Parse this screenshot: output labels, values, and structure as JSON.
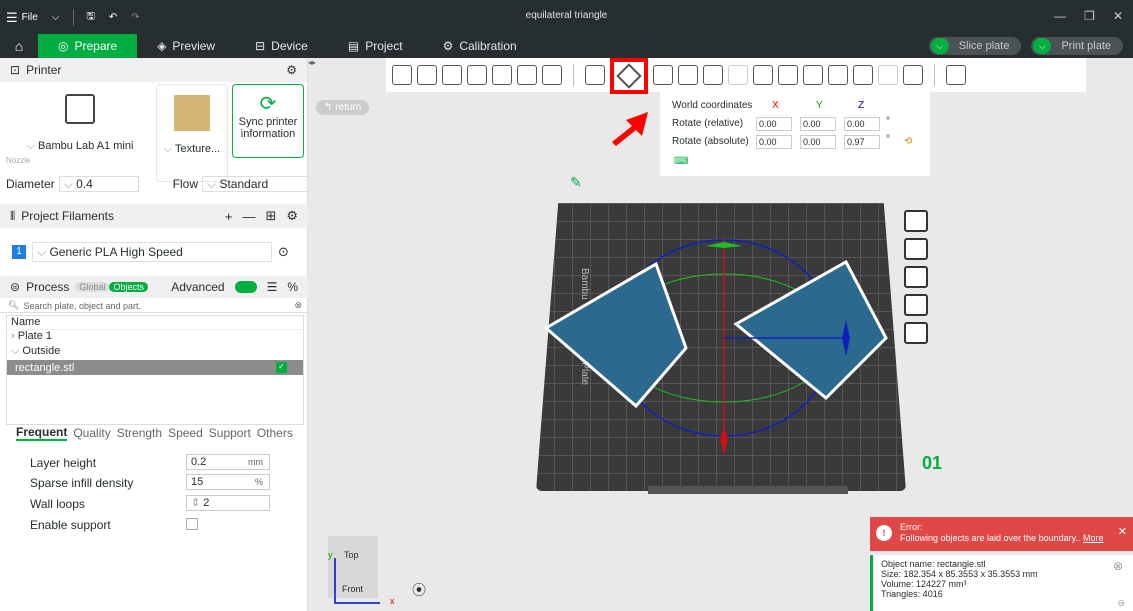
{
  "titlebar": {
    "menu": "File",
    "title": "equilateral triangle"
  },
  "nav": {
    "tabs": [
      "Prepare",
      "Preview",
      "Device",
      "Project",
      "Calibration"
    ],
    "slice": "Slice plate",
    "print": "Print plate"
  },
  "printer": {
    "header": "Printer",
    "name": "Bambu Lab A1 mini",
    "plate": "Texture...",
    "sync": "Sync printer information",
    "nozzle": "Nozzle",
    "diameter_label": "Diameter",
    "diameter": "0.4",
    "flow_label": "Flow",
    "flow": "Standard"
  },
  "filaments": {
    "header": "Project Filaments",
    "slot": "1",
    "name": "Generic PLA High Speed"
  },
  "process": {
    "header": "Process",
    "global": "Global",
    "objects": "Objects",
    "advanced": "Advanced",
    "search_placeholder": "Search plate, object and part.",
    "name_col": "Name",
    "tree": [
      "Plate 1",
      "Outside",
      "rectangle.stl"
    ]
  },
  "tabs": [
    "Frequent",
    "Quality",
    "Strength",
    "Speed",
    "Support",
    "Others"
  ],
  "params": [
    {
      "label": "Layer height",
      "value": "0.2",
      "unit": "mm"
    },
    {
      "label": "Sparse infill density",
      "value": "15",
      "unit": "%"
    },
    {
      "label": "Wall loops",
      "value": "2",
      "unit": ""
    },
    {
      "label": "Enable support",
      "value": "",
      "unit": ""
    }
  ],
  "rotation": {
    "world": "World coordinates",
    "x": "X",
    "y": "Y",
    "z": "Z",
    "rel_label": "Rotate (relative)",
    "rel": [
      "0.00",
      "0.00",
      "0.00"
    ],
    "abs_label": "Rotate (absolute)",
    "abs": [
      "0.00",
      "0.00",
      "0.97"
    ],
    "deg": "°"
  },
  "viewport": {
    "return": "return",
    "plate_num": "01",
    "plate_text": "Bambu Textured PEI Plate",
    "cube_top": "Top",
    "cube_front": "Front",
    "axis_x": "x",
    "axis_y": "y"
  },
  "error": {
    "title": "Error:",
    "msg": "Following objects are laid over the boundary..",
    "more": "More"
  },
  "info": {
    "name": "Object name: rectangle.stl",
    "size": "Size: 182.354 x 85.3553 x 35.3553 mm",
    "volume": "Volume: 124227 mm³",
    "triangles": "Triangles: 4016"
  },
  "colors": {
    "accent": "#00ae42",
    "dark": "#262e30",
    "error": "#e04848",
    "highlight": "#ff0000"
  }
}
